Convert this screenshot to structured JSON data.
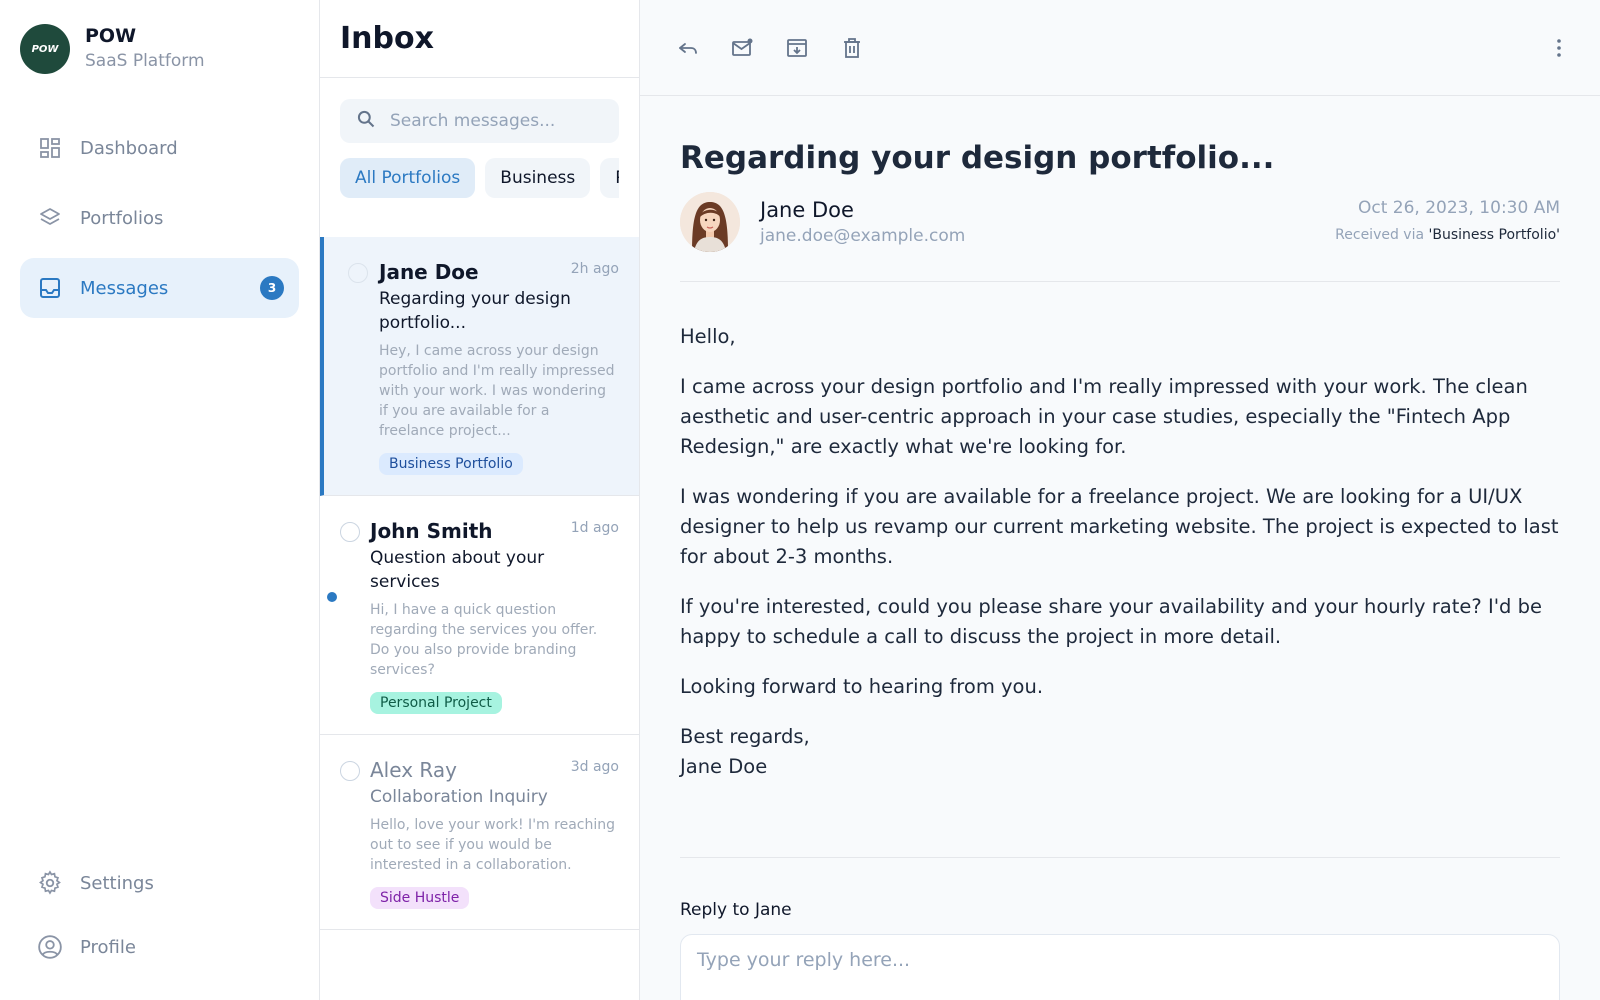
{
  "brand": {
    "logo_text": "POW",
    "name": "POW",
    "subtitle": "SaaS Platform"
  },
  "nav": {
    "items": [
      {
        "label": "Dashboard",
        "icon": "dashboard-icon"
      },
      {
        "label": "Portfolios",
        "icon": "layers-icon"
      },
      {
        "label": "Messages",
        "icon": "inbox-icon",
        "badge": "3",
        "active": true
      }
    ],
    "bottom": [
      {
        "label": "Settings",
        "icon": "gear-icon"
      },
      {
        "label": "Profile",
        "icon": "user-circle-icon"
      }
    ]
  },
  "inbox": {
    "title": "Inbox",
    "search_placeholder": "Search messages...",
    "filters": [
      "All Portfolios",
      "Business",
      "Personal"
    ],
    "messages": [
      {
        "sender": "Jane Doe",
        "time": "2h ago",
        "subject": "Regarding your design portfolio...",
        "preview": "Hey, I came across your design portfolio and I'm really impressed with your work. I was wondering if you are available for a freelance project...",
        "tag": "Business Portfolio",
        "tag_bg": "#dbeafe",
        "tag_color": "#1e4f9c"
      },
      {
        "sender": "John Smith",
        "time": "1d ago",
        "subject": "Question about your services",
        "preview": "Hi, I have a quick question regarding the services you offer. Do you also provide branding services?",
        "tag": "Personal Project",
        "tag_bg": "#a7f3e0",
        "tag_color": "#0f5c47"
      },
      {
        "sender": "Alex Ray",
        "time": "3d ago",
        "subject": "Collaboration Inquiry",
        "preview": "Hello, love your work! I'm reaching out to see if you would be interested in a collaboration.",
        "tag": "Side Hustle",
        "tag_bg": "#f3e1fb",
        "tag_color": "#7e22a8"
      }
    ]
  },
  "detail": {
    "subject": "Regarding your design portfolio...",
    "sender_name": "Jane Doe",
    "sender_email": "jane.doe@example.com",
    "date": "Oct 26, 2023, 10:30 AM",
    "received_prefix": "Received via ",
    "received_portfolio": "'Business Portfolio'",
    "body": [
      "Hello,",
      "I came across your design portfolio and I'm really impressed with your work. The clean aesthetic and user-centric approach in your case studies, especially the \"Fintech App Redesign,\" are exactly what we're looking for.",
      "I was wondering if you are available for a freelance project. We are looking for a UI/UX designer to help us revamp our current marketing website. The project is expected to last for about 2-3 months.",
      "If you're interested, could you please share your availability and your hourly rate? I'd be happy to schedule a call to discuss the project in more detail.",
      "Looking forward to hearing from you.",
      "Best regards,",
      "Jane Doe"
    ],
    "reply_label": "Reply to Jane",
    "reply_placeholder": "Type your reply here...",
    "toolbar_icons": [
      "reply-icon",
      "mark-unread-icon",
      "archive-icon",
      "trash-icon",
      "more-vertical-icon"
    ]
  },
  "colors": {
    "accent": "#2b79c2",
    "active_bg": "#e7f1fb",
    "logo_bg": "#1f4a3c"
  }
}
